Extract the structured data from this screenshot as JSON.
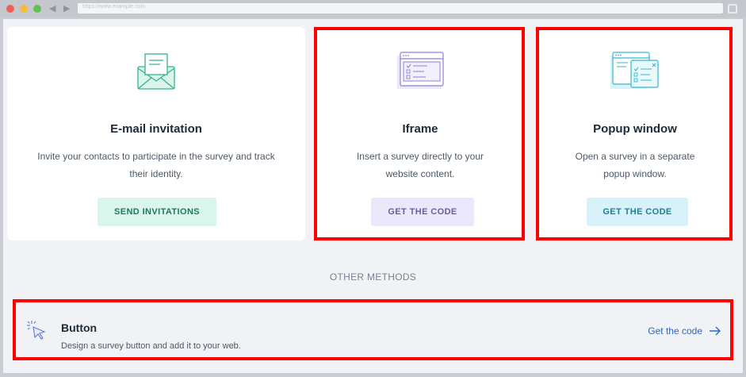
{
  "browser": {
    "address_text": "https://www.example.com"
  },
  "cards": {
    "email": {
      "title": "E-mail invitation",
      "description": "Invite your contacts to participate in the survey and track their identity.",
      "button": "SEND INVITATIONS",
      "icon": "envelope-icon"
    },
    "iframe": {
      "title": "Iframe",
      "description": "Insert a survey directly to your website content.",
      "button": "GET THE CODE",
      "icon": "iframe-window-icon"
    },
    "popup": {
      "title": "Popup window",
      "description": "Open a survey in a separate popup window.",
      "button": "GET THE CODE",
      "icon": "popup-window-icon"
    }
  },
  "other_methods": {
    "label": "OTHER METHODS",
    "button_method": {
      "title": "Button",
      "description": "Design a survey button and add it to your web.",
      "link": "Get the code",
      "icon": "cursor-click-icon"
    }
  },
  "colors": {
    "highlight": "#ff0000",
    "email_button_bg": "#d9f5ec",
    "iframe_button_bg": "#ece8fb",
    "popup_button_bg": "#d7f3f9",
    "link": "#2a66c9"
  }
}
